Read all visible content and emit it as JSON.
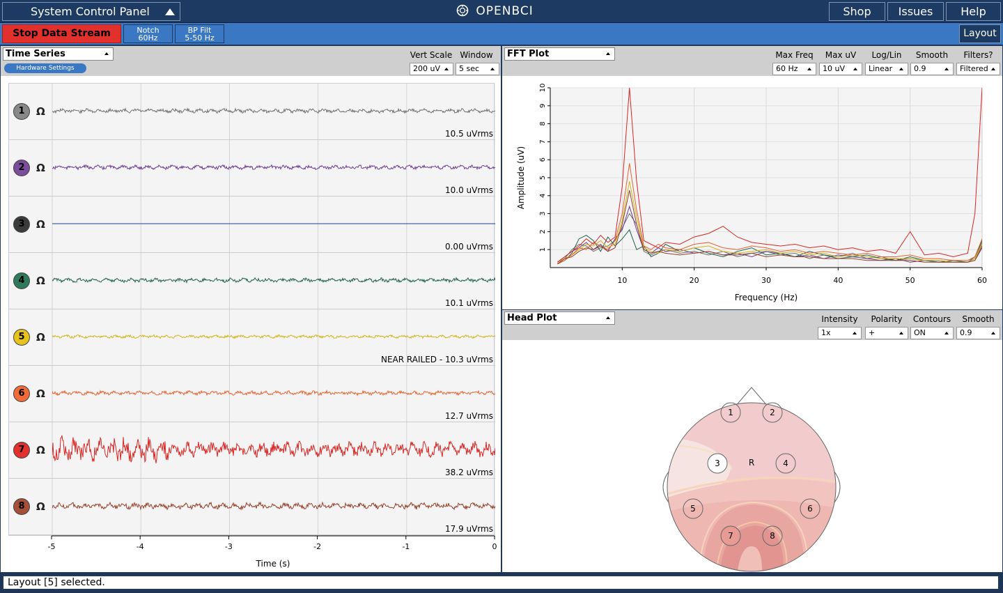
{
  "topbar": {
    "system_control_panel": "System Control Panel",
    "logo": "OPENBCI",
    "shop": "Shop",
    "issues": "Issues",
    "help": "Help"
  },
  "toolbar": {
    "stop_stream": "Stop Data Stream",
    "notch_line1": "Notch",
    "notch_line2": "60Hz",
    "bp_line1": "BP Filt",
    "bp_line2": "5-50 Hz",
    "layout": "Layout"
  },
  "time_series": {
    "title": "Time Series",
    "hardware_settings": "Hardware Settings",
    "vert_scale_label": "Vert Scale",
    "vert_scale_value": "200 uV",
    "window_label": "Window",
    "window_value": "5 sec",
    "x_ticks": [
      "-5",
      "-4",
      "-3",
      "-2",
      "-1",
      "0"
    ],
    "x_axis_label": "Time (s)",
    "channels": [
      {
        "num": "1",
        "omega": "Ω",
        "rms": "10.5 uVrms",
        "color": "#888888",
        "trace": "#707070"
      },
      {
        "num": "2",
        "omega": "Ω",
        "rms": "10.0 uVrms",
        "color": "#7b4d9c",
        "trace": "#6a3d8f"
      },
      {
        "num": "3",
        "omega": "Ω",
        "rms": "0.00 uVrms",
        "color": "#3b3b3b",
        "trace": "#1f3f8a"
      },
      {
        "num": "4",
        "omega": "Ω",
        "rms": "10.1 uVrms",
        "color": "#2f7a5a",
        "trace": "#1f6248"
      },
      {
        "num": "5",
        "omega": "Ω",
        "rms": "NEAR RAILED - 10.3 uVrms",
        "color": "#e6c21c",
        "trace": "#d4b21a"
      },
      {
        "num": "6",
        "omega": "Ω",
        "rms": "12.7 uVrms",
        "color": "#f06a3a",
        "trace": "#e8622f"
      },
      {
        "num": "7",
        "omega": "Ω",
        "rms": "38.2 uVrms",
        "color": "#e2302c",
        "trace": "#d92622"
      },
      {
        "num": "8",
        "omega": "Ω",
        "rms": "17.9 uVrms",
        "color": "#a6503a",
        "trace": "#96402a"
      }
    ]
  },
  "fft": {
    "title": "FFT Plot",
    "labels": [
      "Max Freq",
      "Max uV",
      "Log/Lin",
      "Smooth",
      "Filters?"
    ],
    "values": [
      "60 Hz",
      "10 uV",
      "Linear",
      "0.9",
      "Filtered"
    ]
  },
  "head_plot": {
    "title": "Head Plot",
    "labels": [
      "Intensity",
      "Polarity",
      "Contours",
      "Smooth"
    ],
    "values": [
      "1x",
      "+",
      "ON",
      "0.9"
    ],
    "electrodes": [
      "1",
      "2",
      "3",
      "4",
      "5",
      "6",
      "7",
      "8"
    ],
    "reference": "R"
  },
  "chart_data": {
    "type": "line",
    "xlabel": "Frequency (Hz)",
    "ylabel": "Amplitude (uV)",
    "xlim": [
      0,
      60
    ],
    "ylim": [
      0,
      10
    ],
    "x_ticks": [
      "10",
      "20",
      "30",
      "40",
      "50",
      "60"
    ],
    "y_ticks": [
      "1",
      "2",
      "3",
      "4",
      "5",
      "6",
      "7",
      "8",
      "9",
      "10"
    ],
    "x": [
      1,
      2,
      3,
      4,
      5,
      6,
      7,
      8,
      9,
      10,
      11,
      12,
      13,
      14,
      15,
      16,
      18,
      20,
      22,
      24,
      26,
      28,
      30,
      32,
      34,
      36,
      38,
      40,
      42,
      44,
      46,
      48,
      50,
      52,
      54,
      56,
      58,
      59,
      60
    ],
    "series": [
      {
        "color": "#707070",
        "values": [
          0.2,
          0.5,
          1.0,
          1.3,
          1.2,
          0.9,
          1.1,
          1.2,
          1.5,
          2.2,
          3.0,
          2.4,
          0.9,
          0.7,
          0.9,
          1.0,
          0.8,
          0.9,
          0.7,
          0.9,
          0.6,
          0.8,
          0.9,
          0.7,
          0.8,
          0.5,
          0.7,
          0.6,
          0.8,
          0.5,
          0.6,
          0.4,
          0.5,
          0.4,
          0.3,
          0.3,
          0.3,
          0.5,
          1.4
        ]
      },
      {
        "color": "#6a3d8f",
        "values": [
          0.3,
          0.6,
          0.9,
          1.1,
          1.4,
          1.0,
          1.3,
          0.9,
          1.6,
          2.1,
          3.4,
          2.1,
          1.0,
          0.8,
          1.1,
          0.9,
          1.0,
          0.8,
          0.9,
          0.7,
          0.8,
          0.6,
          0.9,
          0.8,
          0.6,
          0.7,
          0.5,
          0.7,
          0.6,
          0.5,
          0.4,
          0.5,
          0.3,
          0.4,
          0.4,
          0.3,
          0.3,
          0.4,
          1.1
        ]
      },
      {
        "color": "#1f6248",
        "values": [
          0.2,
          0.4,
          0.8,
          1.6,
          1.8,
          1.5,
          0.9,
          1.7,
          1.2,
          1.6,
          2.1,
          1.0,
          1.2,
          0.6,
          0.8,
          1.3,
          0.9,
          1.1,
          0.8,
          0.6,
          0.9,
          1.1,
          0.7,
          0.8,
          0.6,
          0.9,
          0.7,
          0.5,
          0.6,
          0.7,
          0.5,
          0.4,
          0.6,
          0.4,
          0.3,
          0.4,
          0.3,
          0.6,
          1.5
        ]
      },
      {
        "color": "#d4b21a",
        "values": [
          0.3,
          0.5,
          0.7,
          1.0,
          1.3,
          1.2,
          1.5,
          1.1,
          1.3,
          2.6,
          4.8,
          2.8,
          1.1,
          0.9,
          0.8,
          1.0,
          0.9,
          1.1,
          1.2,
          0.9,
          0.8,
          0.9,
          1.0,
          0.8,
          0.9,
          0.7,
          0.8,
          0.6,
          0.7,
          0.6,
          0.5,
          0.5,
          0.5,
          0.4,
          0.4,
          0.3,
          0.3,
          0.5,
          1.3
        ]
      },
      {
        "color": "#e8622f",
        "values": [
          0.2,
          0.4,
          0.7,
          1.1,
          1.0,
          1.4,
          1.2,
          1.0,
          1.5,
          3.0,
          5.8,
          3.2,
          1.2,
          1.0,
          1.3,
          1.1,
          1.0,
          1.3,
          1.4,
          1.1,
          1.0,
          1.2,
          1.1,
          0.9,
          1.0,
          0.8,
          0.9,
          0.8,
          0.7,
          0.8,
          0.6,
          0.6,
          0.7,
          0.5,
          0.5,
          0.4,
          0.4,
          0.6,
          1.6
        ]
      },
      {
        "color": "#d92622",
        "values": [
          0.3,
          0.6,
          0.9,
          1.2,
          1.6,
          1.3,
          1.8,
          1.4,
          1.7,
          4.5,
          10.0,
          4.8,
          1.5,
          1.3,
          1.1,
          1.4,
          1.3,
          1.7,
          1.9,
          2.3,
          1.7,
          1.4,
          1.3,
          1.2,
          1.3,
          1.1,
          1.2,
          1.0,
          1.1,
          0.9,
          1.0,
          0.8,
          2.0,
          0.7,
          0.8,
          0.6,
          0.8,
          3.0,
          10.0
        ]
      },
      {
        "color": "#96402a",
        "values": [
          0.2,
          0.5,
          0.6,
          0.9,
          1.1,
          1.0,
          1.2,
          0.9,
          1.1,
          2.4,
          4.3,
          2.4,
          1.0,
          0.8,
          0.9,
          0.8,
          0.7,
          0.8,
          0.9,
          0.7,
          0.7,
          0.8,
          0.6,
          0.7,
          0.6,
          0.6,
          0.5,
          0.5,
          0.5,
          0.4,
          0.4,
          0.4,
          0.4,
          0.3,
          0.3,
          0.3,
          0.3,
          0.4,
          1.2
        ]
      }
    ]
  },
  "status_bar": {
    "message": "Layout [5] selected."
  }
}
